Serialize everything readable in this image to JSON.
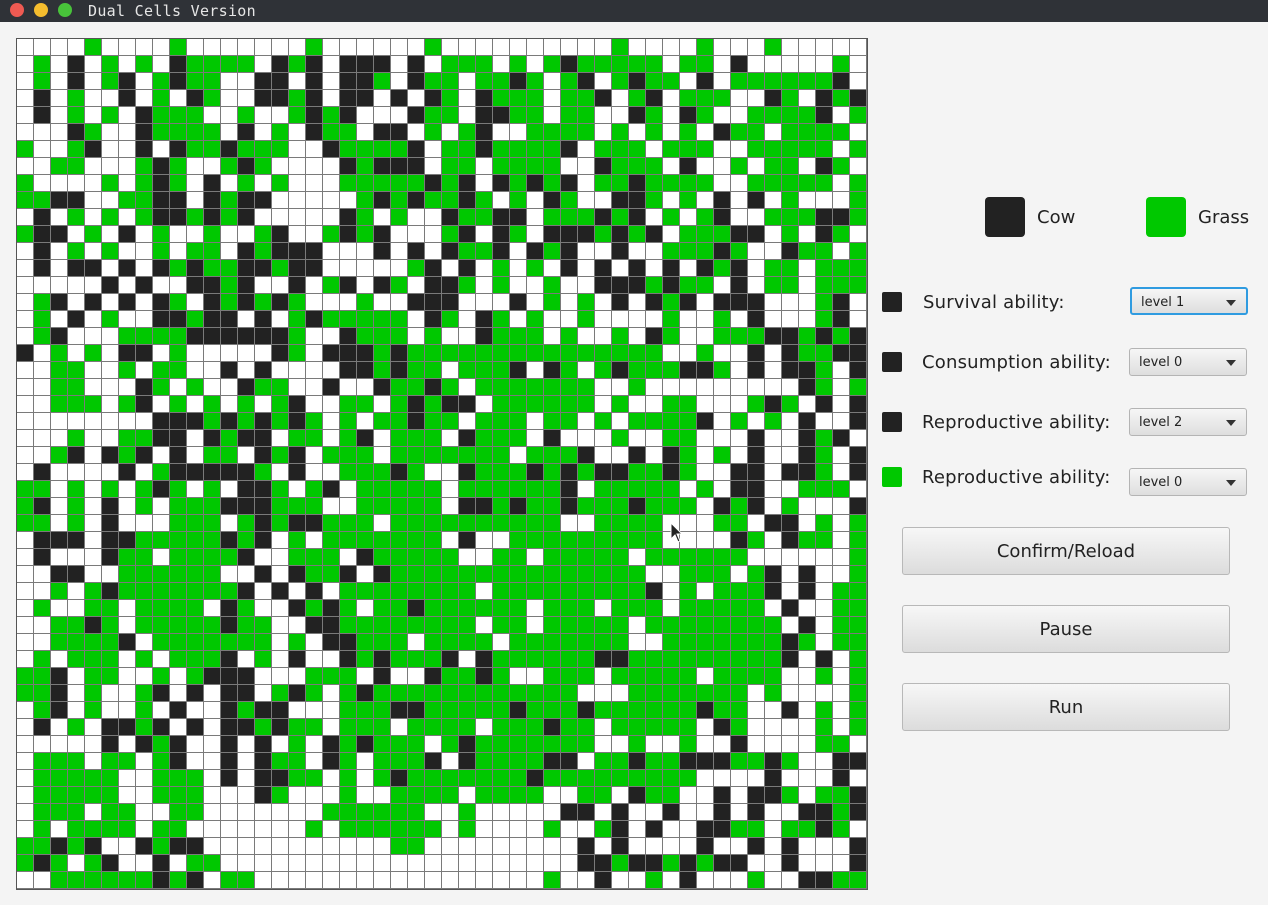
{
  "window": {
    "title": "Dual Cells Version"
  },
  "colors": {
    "cow": "#222222",
    "grass": "#00c800",
    "empty": "#ffffff"
  },
  "legend": {
    "cow_label": "Cow",
    "grass_label": "Grass"
  },
  "settings": [
    {
      "species": "cow",
      "label": "Survival ability:",
      "value": "level 1",
      "focused": true
    },
    {
      "species": "cow",
      "label": "Consumption ability:",
      "value": "level 0",
      "focused": false
    },
    {
      "species": "cow",
      "label": "Reproductive ability:",
      "value": "level 2",
      "focused": false
    },
    {
      "species": "grass",
      "label": "Reproductive ability:",
      "value": "level 0",
      "focused": false
    }
  ],
  "buttons": {
    "confirm": "Confirm/Reload",
    "pause": "Pause",
    "run": "Run"
  },
  "grid": {
    "size": 50,
    "legend": {
      "k": "cow",
      "g": "grass",
      "w": "empty"
    },
    "rows": [
      "wwwwgwwwwgwwwwwwwgwwwwwwgwwwwwwwwwwgwwwwgwwwgwwwww",
      "wgwkwgwgwkggggwkgkwkkkwkwgggwgwgkgggggwggwkwwwwwgw",
      "wgwkwgkwgkggwwkkwkwkkgwkggwggkgwgkwgkggwkwggggggkw",
      "wkwgwwkwgwkgwwkkgkwkkwkwkgwkgggwggkwgkwgggwwkgwkgk",
      "wkwgwgwkgggwwgwwgkgkwwwkggwkkggwggwwkgwkgwwggggkwg",
      "wwwkgwwkggggwkwgwkggwkkwgwgkwwggggwgwgwgwkggwggggw",
      "gwwgkwwkwkggkgggwwkggggkwggkggggkwgggwgggwwgggggwg",
      "wwggwwwgkgwwgkgwwwwkgkkkwggwggggwwkgggwkwwgwggwkgw",
      "gwwwwgwgkgwkwgwgwwwgggggkgkwkgkgkwggkggggwwgggggwg",
      "ggkkwwggkkwkgkkwwwwwgkgkggkgwgwkgwwkkgwgwkwkwgwwwg",
      "wkwgwgwgkkgkgkwwwwwkgwgwwkggkkwgggkgkwgwgkwwgggkkg",
      "gkkwgwkwgwwgwwgkwwgkgkwwwgkwkgwkkkgkgkwgggkkwgwkgw",
      "wkwgwgwwgwggwkgkkkwwwkwkwkggkwkgkwwkwwgggkgwwkggwg",
      "wkwkkwkwkgkggkkgkkwwwwwgkwkwgwgwkwkwkwkwkgkwggwggg",
      "wwwwwkwkwwkkgkwwkwgkwkgwkkgwgwwgwwkkkgkggwkwggwggg",
      "wgkwkwkwkgwkgkgkgwwwgwwkkkwwwkwgwgwkwkgkwkkkwwwgkw",
      "wgwkwgwwkkgkkwkwgkgggggwkgwkgwgwwgwwwwgwwgwkwwwgkw",
      "wgkwwwggggkkkkkkgwwkgggwgwwkgggwgwwgwkgwwgggkkgkgk",
      "kwgwgwkkwgwwwwwkgwkkkgkgggggggggggggggwwgwwkwkggkk",
      "wwggwwgwggwwkwkwwwwkkgkggwgggkwkgwgkgggkkgwkwkkgwk",
      "wwggwwwkgwgwwkggwwkwwkggkgwgggggggwwgwwwwwwwwwkgwg",
      "wwgggwgkwgwgwgwgkwwggwgkgkkwggggggwgwwggwwwgkgwkwk",
      "wwwwwwwwkkkgkgkgkgwgwggkggwgggwggwgwggggkwgwgwkwwk",
      "wwwgwwggkkwkgkkwggwgkwgggwkgggwkwwwgwwggwwwkwwkgkw",
      "wwgkwkgkwkwggwkgkwgggwgggggggwgggkwwkwkgwgwkwwkgwk",
      "wkwwwwkwgkkkkkgwkwwgggkgwwkgggkgkgkkggkgwwkkwkkgwk",
      "ggwgwgwgkgwgwkkgwgkwgggggwggggggkwgggggwgwkkwwgggw",
      "gkwgwkwgwgggkkkgggwwgggggwkkgkggkgggkgggwkgkwgwwwk",
      "ggwgwkwwwgggwgkgkkgggwggggggggggwwggggwwwggwkkwgwg",
      "wkkkwkkgggggkgkwgwgggggggwkwwgggggggggwwwwkgwkggwg",
      "wkwwwkggwggggkwwgggwkgggggwwggwgggggwggggggwwwwwwg",
      "wwkkwwggggggwwkwkggkwkgggggggggggggggwwgggwgkwkwwg",
      "wwgwgkgggggggkwkwkwggggggggwgggggggggkwgwgggkwkwgg",
      "wgwwggwggggwkgwwkgkgwggkggggggwgggwgggwgggggwkwwgg",
      "wwggkgwgggggkggwwkkggggggggwggwgggggwggggggggwkwgg",
      "wwggggkwgggggggwgwkkgggwggggwgggggggwwgggggggkgwgg",
      "wgwgggwgwgggkwgwkwwkgkgggkwkggggggkkgggggggggkwkwg",
      "ggkwggwwgwgkkkwwwgggwkwwkggkgwwgggwgggggwggggwwgwg",
      "ggkwgwwgkwkwkkwgkgwgkggggggggggggwwwgggggggwgwwwwg",
      "wgkwgwwgwkwwkgkkwwwgggkkgggggkgggkggggggkggwwkwgwg",
      "wkwgwkkgkwkwkkgkggwgggwggggwgggkggwgggggwkgwwwwgwg",
      "wwwwwkwkgkwwkwkwgwkgkgggwgkgggggggwwgwwgwwkwwwwggw",
      "wgggwggwgkwwkwkggwkgwgggkwkggggkkwggkggkkkggkgwwkk",
      "wgggggwwgggwkwkkggwgwgkgggggggkgggggggggwwwwkwwwkw",
      "wgggggwwgggwwwkgwwwgwwggggwggggwwggwkggwwkwkkgwggk",
      "wgggwggwwggwwwwwwwggggggwwgwwwwwkkwkwwkwwkwkwwkkgk",
      "wgwggggwggwwwwwwwgwggggggwgwwwwgwwgkwkwwkkggwggkgw",
      "ggkgkwwkgkkwwwwwwwwwwwggwwwwwwwwwkwkwwwwkwwkwkwwwk",
      "gkgwgkwwkwggwwwwwwwwwwwwwwwwwwwwwkkgkkgkgkkwwkwwwk",
      "wwggggggkgkwggwwwwwwwwwwwwwwwwwgwwkwwgwkwwwgwwkkgg"
    ]
  }
}
